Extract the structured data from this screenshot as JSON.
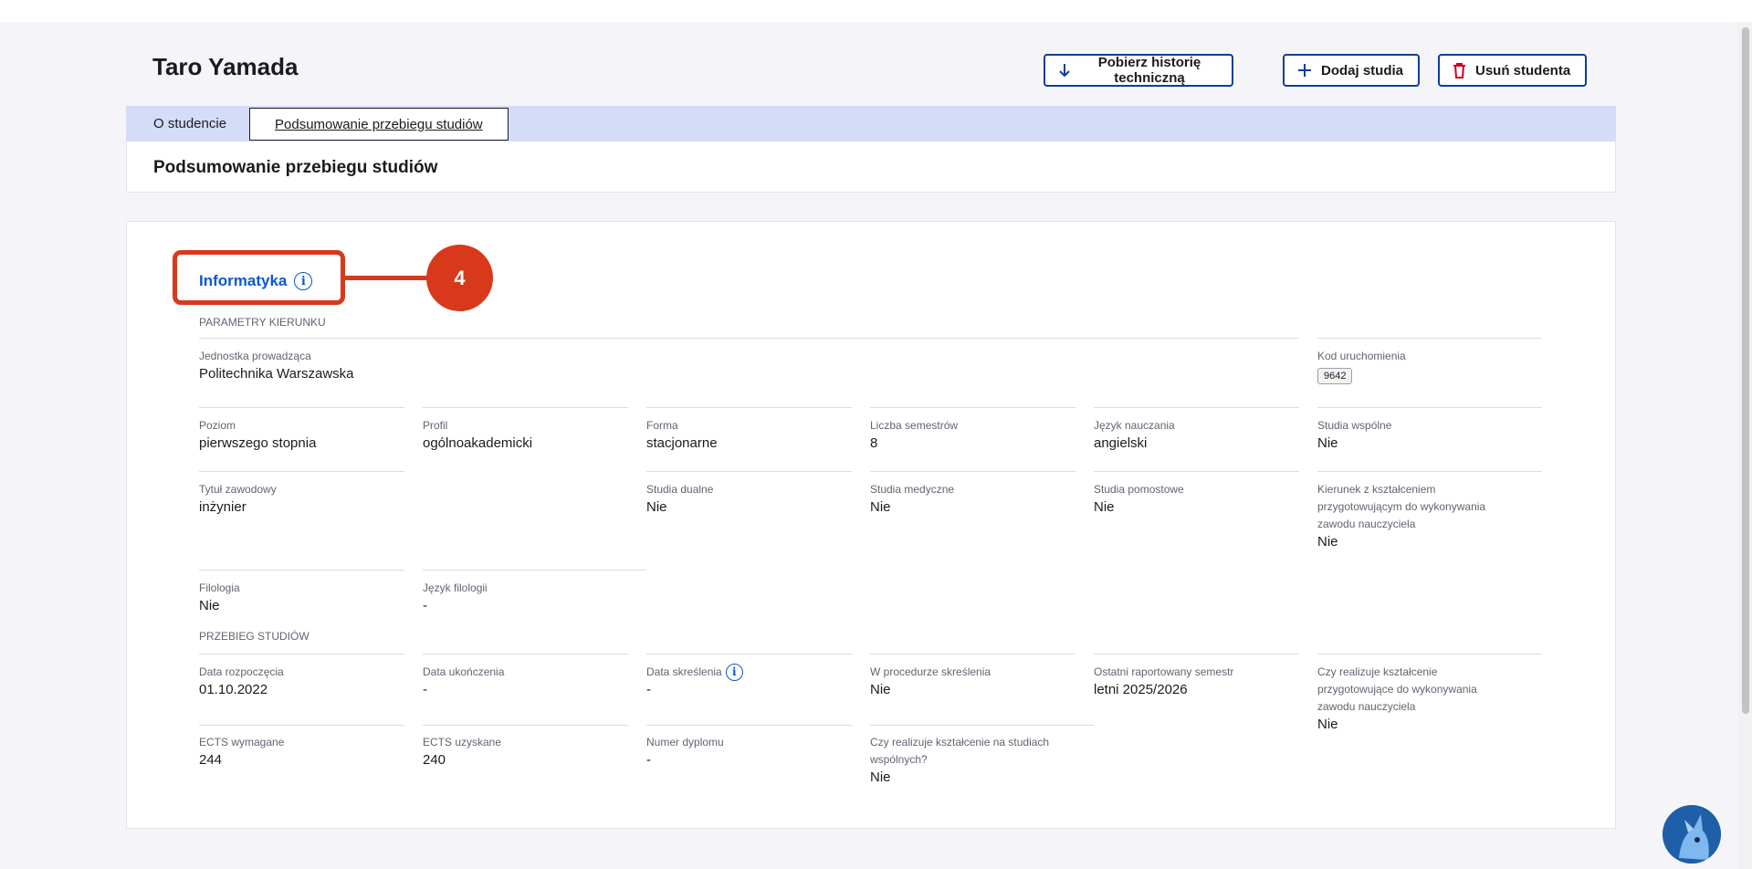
{
  "student": {
    "name": "Taro Yamada"
  },
  "actions": {
    "download_history": "Pobierz historię techniczną",
    "add_studies": "Dodaj studia",
    "remove_student": "Usuń studenta"
  },
  "tabs": [
    "O studencie",
    "Podsumowanie przebiegu studiów"
  ],
  "page": {
    "section_title": "Podsumowanie przebiegu studiów"
  },
  "course": {
    "name": "Informatyka"
  },
  "callout": {
    "number": "4",
    "color": "#d9391b"
  },
  "sections": {
    "params": "PARAMETRY KIERUNKU",
    "progress": "PRZEBIEG STUDIÓW"
  },
  "params": {
    "unit": {
      "label": "Jednostka prowadząca",
      "value": "Politechnika Warszawska"
    },
    "launch_code": {
      "label": "Kod uruchomienia",
      "value": "9642"
    },
    "level": {
      "label": "Poziom",
      "value": "pierwszego stopnia"
    },
    "profile": {
      "label": "Profil",
      "value": "ogólnoakademicki"
    },
    "form": {
      "label": "Forma",
      "value": "stacjonarne"
    },
    "semesters": {
      "label": "Liczba semestrów",
      "value": "8"
    },
    "language": {
      "label": "Język nauczania",
      "value": "angielski"
    },
    "joint": {
      "label": "Studia wspólne",
      "value": "Nie"
    },
    "title": {
      "label": "Tytuł zawodowy",
      "value": "inżynier"
    },
    "dual": {
      "label": "Studia dualne",
      "value": "Nie"
    },
    "medical": {
      "label": "Studia medyczne",
      "value": "Nie"
    },
    "bridging": {
      "label": "Studia pomostowe",
      "value": "Nie"
    },
    "teacher": {
      "label": "Kierunek z kształceniem przygotowującym do wykonywania zawodu nauczyciela",
      "value": "Nie"
    },
    "philology": {
      "label": "Filologia",
      "value": "Nie"
    },
    "philology_lang": {
      "label": "Język filologii",
      "value": "-"
    }
  },
  "progress": {
    "start": {
      "label": "Data rozpoczęcia",
      "value": "01.10.2022"
    },
    "end": {
      "label": "Data ukończenia",
      "value": "-"
    },
    "removal": {
      "label": "Data skreślenia",
      "value": "-"
    },
    "removal_proc": {
      "label": "W procedurze skreślenia",
      "value": "Nie"
    },
    "last_semester": {
      "label": "Ostatni raportowany semestr",
      "value": "letni 2025/2026"
    },
    "teacher_training": {
      "label": "Czy realizuje kształcenie przygotowujące do wykonywania zawodu nauczyciela",
      "value": "Nie"
    },
    "ects_req": {
      "label": "ECTS wymagane",
      "value": "244"
    },
    "ects_got": {
      "label": "ECTS uzyskane",
      "value": "240"
    },
    "diploma": {
      "label": "Numer dyplomu",
      "value": "-"
    },
    "joint_training": {
      "label": "Czy realizuje kształcenie na studiach wspólnych?",
      "value": "Nie"
    }
  }
}
